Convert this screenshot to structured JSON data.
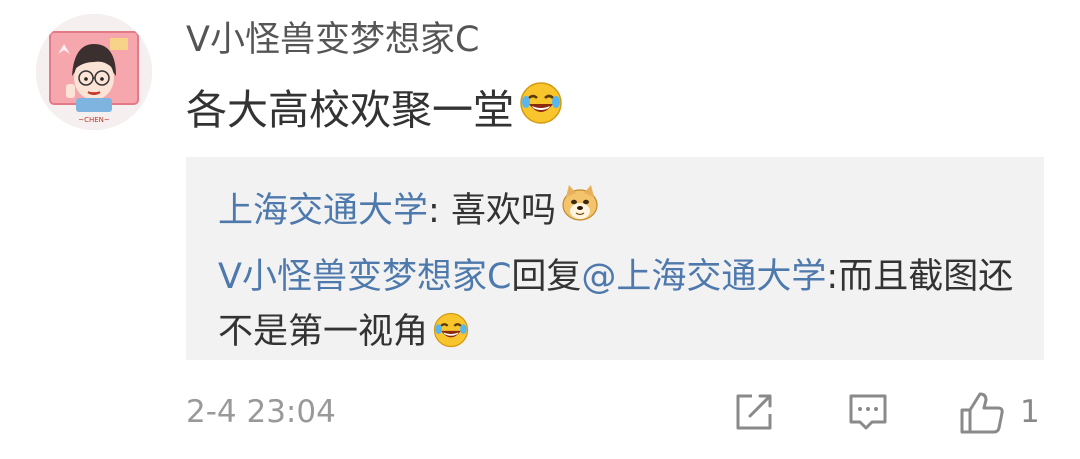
{
  "comment": {
    "username": "V小怪兽变梦想家C",
    "text": "各大高校欢聚一堂",
    "text_emoji": "laugh-cry-emoji",
    "avatar": "cartoon-boy-avatar",
    "avatar_caption": "~CHEN~"
  },
  "replies": [
    {
      "author": "上海交通大学",
      "separator": ": ",
      "text": "喜欢吗",
      "emoji": "doge-emoji"
    },
    {
      "author": "V小怪兽变梦想家C",
      "reply_word": "回复",
      "mention": "@上海交通大学",
      "separator": ":",
      "text": "而且截图还不是第一视角",
      "emoji": "laugh-cry-emoji"
    }
  ],
  "footer": {
    "timestamp": "2-4 23:04",
    "like_count": "1",
    "icons": [
      "share-icon",
      "comment-icon",
      "like-icon"
    ]
  },
  "colors": {
    "link": "#4e79ad",
    "text": "#333333",
    "muted": "#999999",
    "reply_bg": "#f2f2f2"
  }
}
